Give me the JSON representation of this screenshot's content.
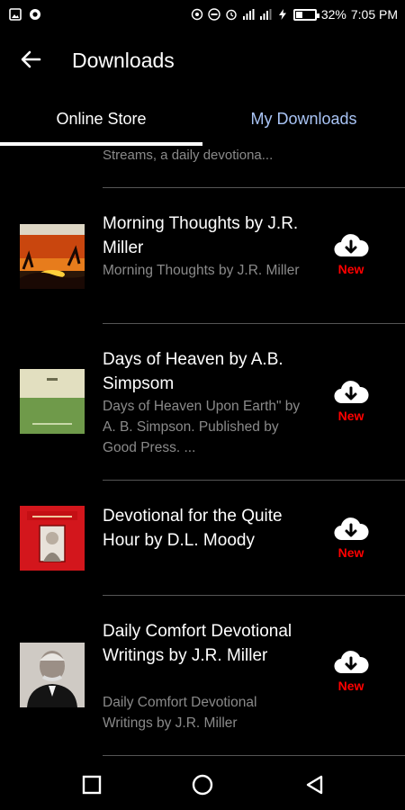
{
  "status_bar": {
    "battery_percent": "32%",
    "time": "7:05 PM",
    "battery_level": 0.32
  },
  "app_bar": {
    "title": "Downloads",
    "back_icon": "arrow-back-icon"
  },
  "tabs": [
    {
      "label": "Online Store",
      "active": true
    },
    {
      "label": "My Downloads",
      "active": false
    }
  ],
  "list": {
    "partial_subtitle": "Streams, a daily devotiona...",
    "items": [
      {
        "title": "Morning Thoughts by J.R. Miller",
        "subtitle": "Morning Thoughts by J.R. Miller",
        "badge": "New",
        "icon": "cloud-download-icon"
      },
      {
        "title": "Days of Heaven by A.B. Simpsom",
        "subtitle": "Days of Heaven Upon Earth\" by A. B. Simpson. Published by Good Press. ...",
        "badge": "New",
        "icon": "cloud-download-icon"
      },
      {
        "title": "Devotional for the Quite Hour by D.L. Moody",
        "subtitle": "",
        "badge": "New",
        "icon": "cloud-download-icon"
      },
      {
        "title": "Daily Comfort Devotional Writings by J.R. Miller",
        "subtitle": "Daily Comfort Devotional Writings by J.R. Miller",
        "badge": "New",
        "icon": "cloud-download-icon"
      }
    ]
  },
  "colors": {
    "background": "#000000",
    "active_tab": "#ffffff",
    "inactive_tab": "#a9c4f5",
    "badge": "#ff0000",
    "subtitle": "#8a8a8a"
  }
}
